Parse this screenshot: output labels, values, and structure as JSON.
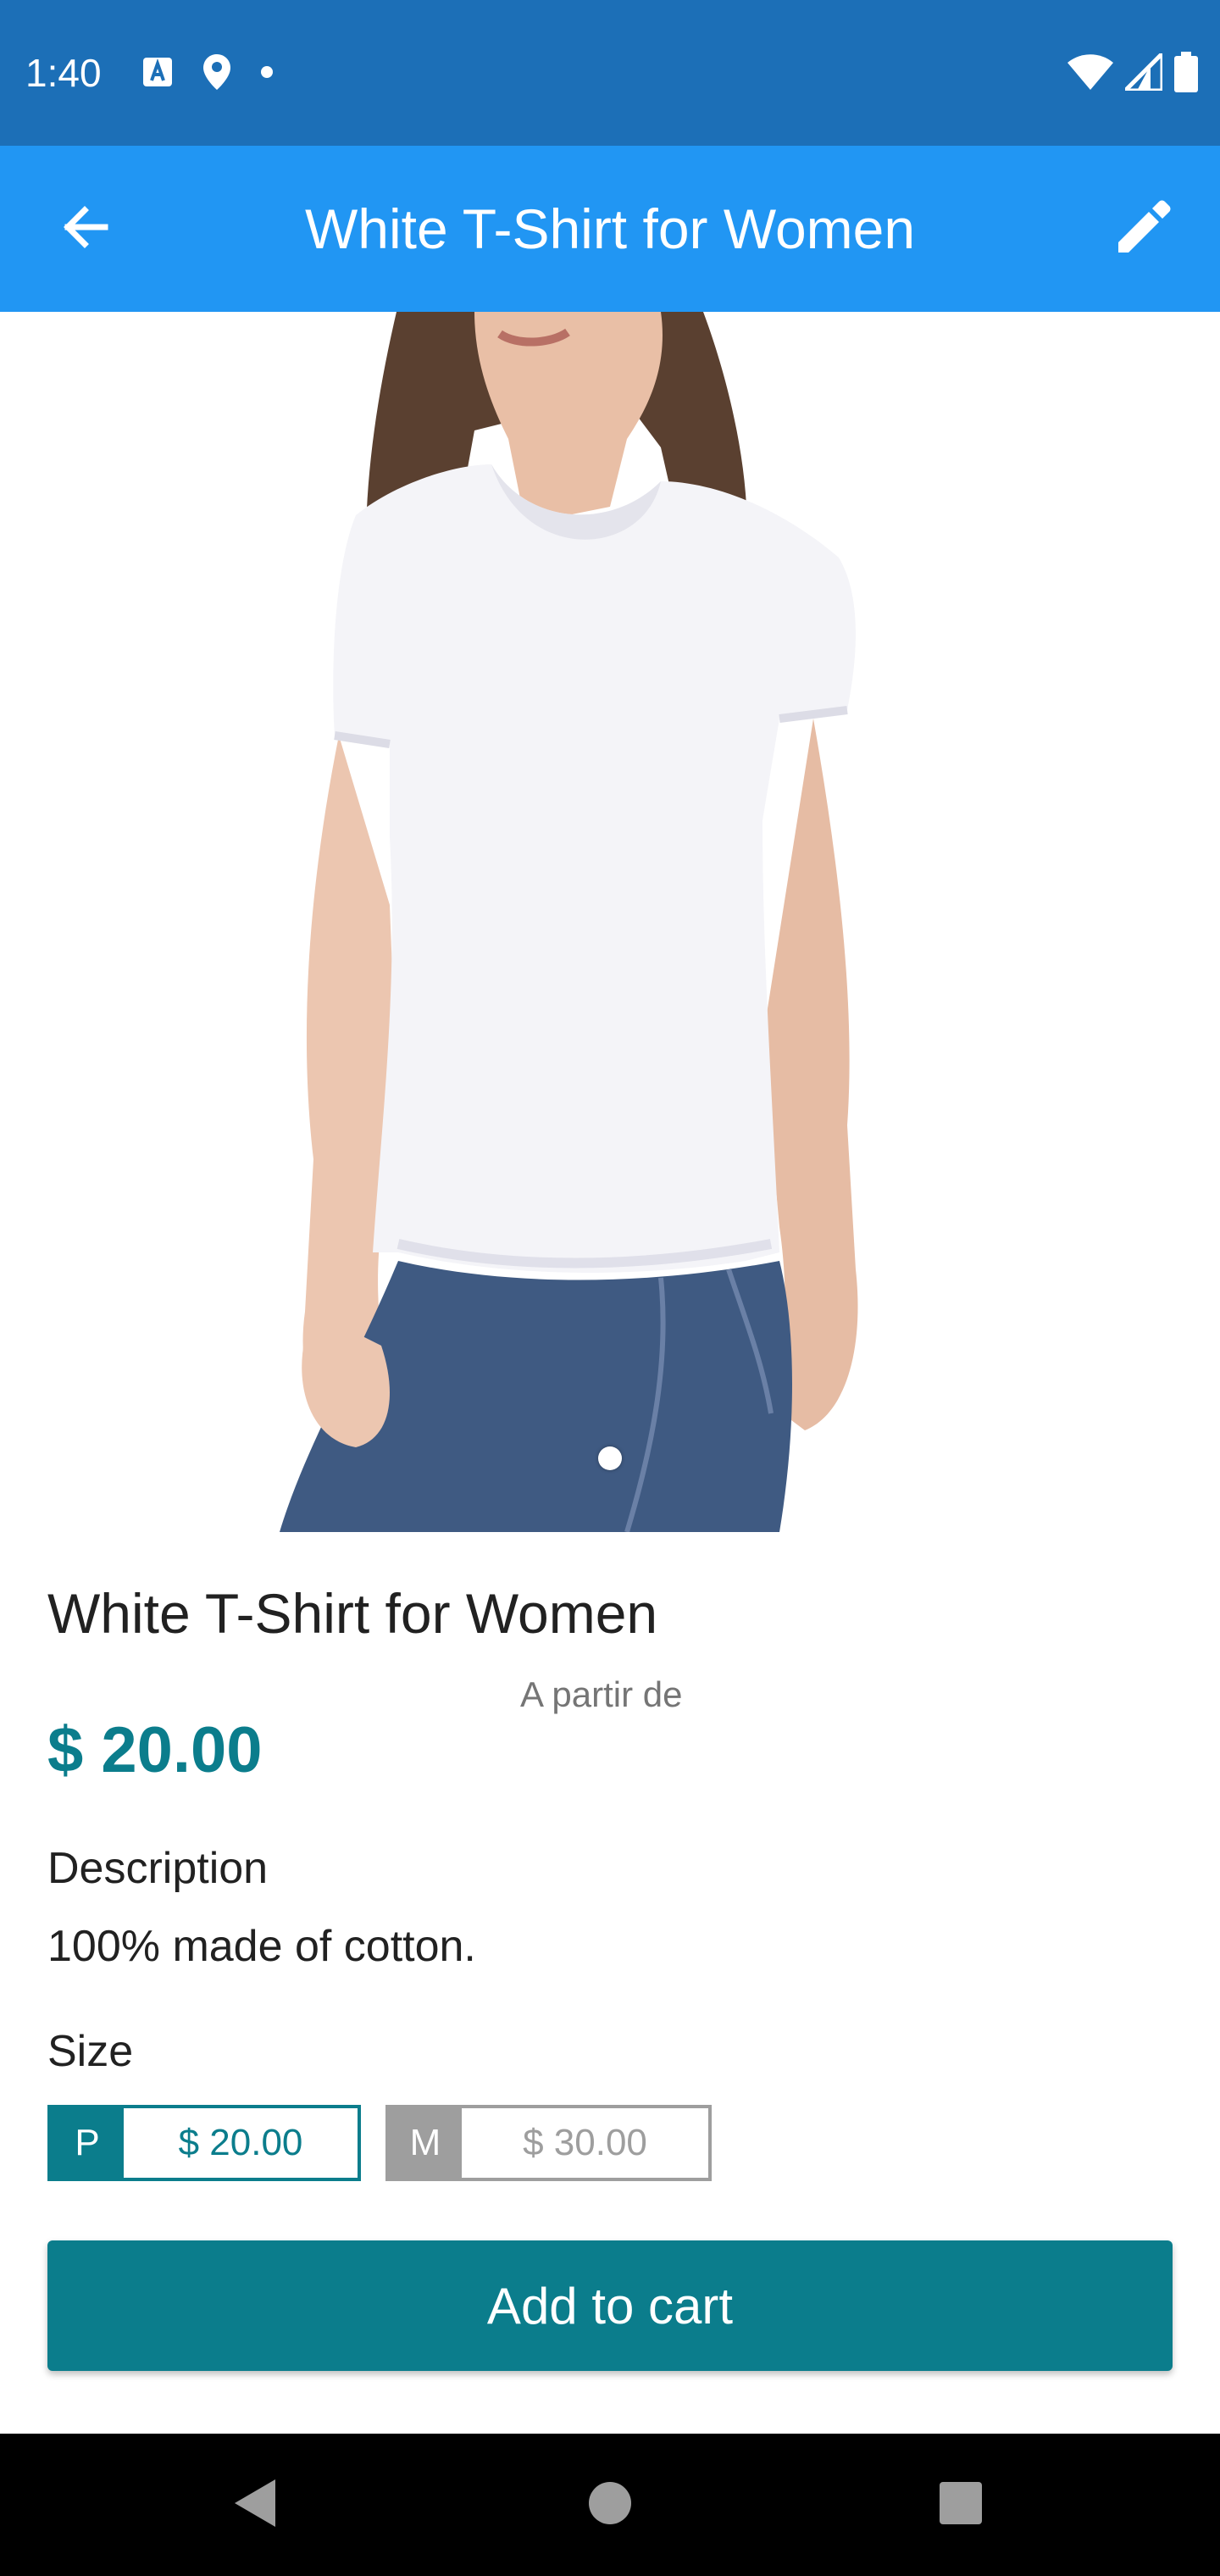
{
  "status_bar": {
    "time": "1:40",
    "icons": [
      "a-notification-icon",
      "location-icon",
      "dot-icon",
      "wifi-icon",
      "signal-icon",
      "battery-icon"
    ]
  },
  "app_bar": {
    "title": "White T-Shirt for Women",
    "back_icon": "arrow-back-icon",
    "edit_icon": "pencil-icon"
  },
  "product": {
    "image_count": 1,
    "name": "White T-Shirt for Women",
    "from_label": "A partir de",
    "price": "$ 20.00",
    "description_heading": "Description",
    "description": "100% made of cotton.",
    "size_heading": "Size",
    "sizes": [
      {
        "code": "P",
        "price": "$ 20.00",
        "selected": true
      },
      {
        "code": "M",
        "price": "$ 30.00",
        "selected": false
      }
    ]
  },
  "actions": {
    "add_to_cart_label": "Add to cart"
  },
  "colors": {
    "status_bar": "#1c6fb7",
    "app_bar": "#2196f3",
    "accent": "#0b7d8c",
    "disabled": "#9e9e9e"
  },
  "nav_bar": {
    "buttons": [
      "back-triangle-icon",
      "home-circle-icon",
      "recents-square-icon"
    ]
  }
}
